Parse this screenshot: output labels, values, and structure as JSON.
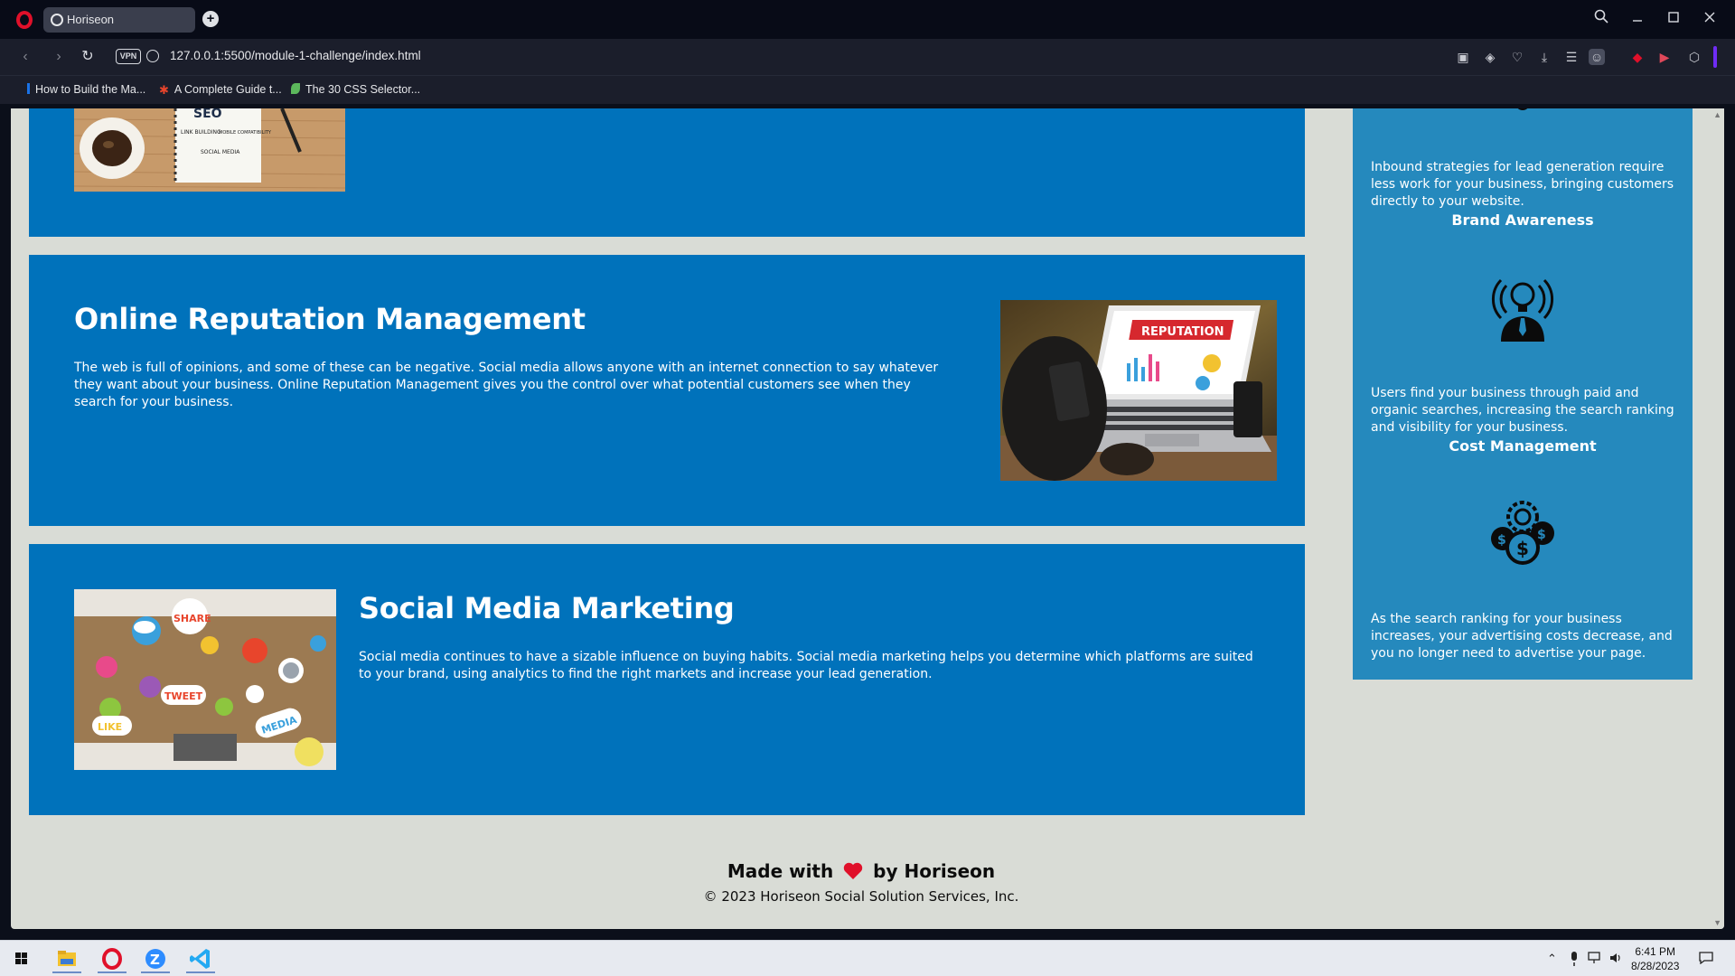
{
  "browser": {
    "tab_title": "Horiseon",
    "new_tab": "+",
    "url": "127.0.0.1:5500/module-1-challenge/index.html",
    "vpn": "VPN",
    "bookmarks": [
      {
        "label": "How to Build the Ma...",
        "color": "#1a73e8"
      },
      {
        "label": "A Complete Guide t...",
        "color": "#e8452c"
      },
      {
        "label": "The 30 CSS Selector...",
        "color": "#5cb85c"
      }
    ]
  },
  "page": {
    "sections": [
      {
        "heading": "Online Reputation Management",
        "text": "The web is full of opinions, and some of these can be negative. Social media allows anyone with an internet connection to say whatever they want about your business. Online Reputation Management gives you the control over what potential customers see when they search for your business.",
        "image_caption": "REPUTATION"
      },
      {
        "heading": "Social Media Marketing",
        "text": "Social media continues to have a sizable influence on buying habits. Social media marketing helps you determine which platforms are suited to your brand, using analytics to find the right markets and increase your lead generation.",
        "image_words": [
          "SHARE",
          "TWEET",
          "LIKE",
          "MEDIA"
        ]
      }
    ],
    "seo_image_words": [
      "SEO",
      "LINK BUILDING",
      "MOBILE COMPATIBILITY",
      "SOCIAL MEDIA"
    ],
    "benefits": [
      {
        "title": "",
        "text": "Inbound strategies for lead generation require less work for your business, bringing customers directly to your website.",
        "icon": "magnet-icon"
      },
      {
        "title": "Brand Awareness",
        "text": "Users find your business through paid and organic searches, increasing the search ranking and visibility for your business.",
        "icon": "lightbulb-person-icon"
      },
      {
        "title": "Cost Management",
        "text": "As the search ranking for your business increases, your advertising costs decrease, and you no longer need to advertise your page.",
        "icon": "money-gear-icon"
      }
    ],
    "footer": {
      "made_with": "Made with",
      "by": "by Horiseon",
      "copyright": "© 2023 Horiseon Social Solution Services, Inc."
    }
  },
  "taskbar": {
    "time": "6:41 PM",
    "date": "8/28/2023"
  },
  "colors": {
    "card_blue": "#0072bb",
    "sidebar_blue": "#2589bd",
    "page_bg": "#d9dcd6",
    "heart": "#e0102a"
  }
}
